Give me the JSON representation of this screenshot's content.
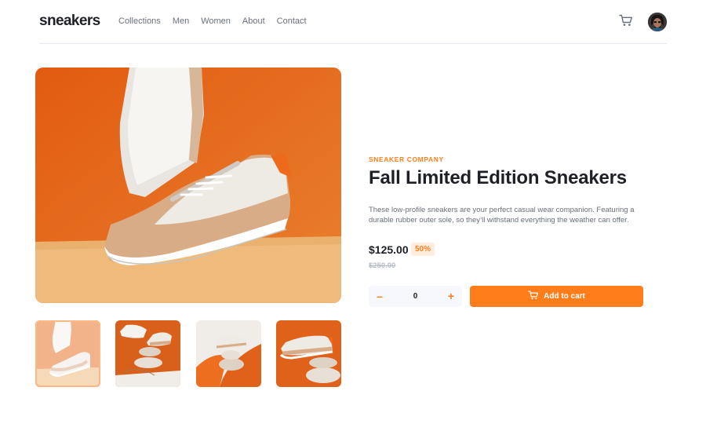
{
  "header": {
    "logo": "sneakers",
    "nav": [
      "Collections",
      "Men",
      "Women",
      "About",
      "Contact"
    ],
    "cart_icon": "cart-icon",
    "avatar": "avatar"
  },
  "gallery": {
    "main_image": "product-image-1",
    "thumbnails": [
      "product-thumbnail-1",
      "product-thumbnail-2",
      "product-thumbnail-3",
      "product-thumbnail-4"
    ],
    "active_thumbnail": 0
  },
  "product": {
    "company": "SNEAKER COMPANY",
    "title": "Fall Limited Edition Sneakers",
    "description": "These low-profile sneakers are your perfect casual wear companion. Featuring a durable rubber outer sole, so they’ll withstand everything the weather can offer.",
    "price": "$125.00",
    "discount": "50%",
    "original_price": "$250.00"
  },
  "cart_controls": {
    "minus": "–",
    "quantity": "0",
    "plus": "+",
    "add_label": "Add to cart"
  },
  "colors": {
    "accent": "#ff7e1b",
    "accent_pale": "#ffede0",
    "text_dark": "#1d2026",
    "text_gray": "#69707d"
  }
}
